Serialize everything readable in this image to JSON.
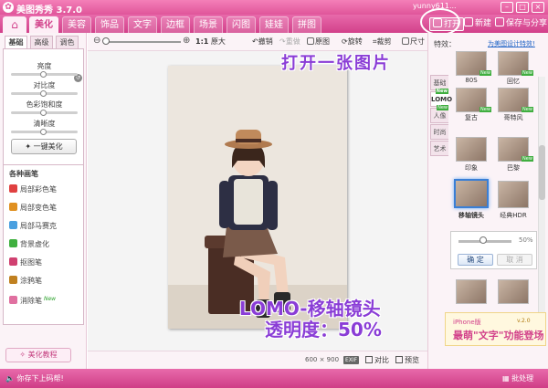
{
  "window": {
    "title": "美图秀秀 3.7.0",
    "user": "yunny611..."
  },
  "tabs": [
    "美化",
    "美容",
    "饰品",
    "文字",
    "边框",
    "场景",
    "闪图",
    "娃娃",
    "拼图"
  ],
  "top_actions": {
    "open": "打开",
    "new": "新建",
    "save": "保存与分享"
  },
  "left_panel": {
    "subtabs": [
      "基础",
      "高级",
      "调色"
    ],
    "sliders": [
      "亮度",
      "对比度",
      "色彩饱和度",
      "清晰度"
    ],
    "one_key": "一键美化",
    "pens_title": "各种画笔",
    "pens": [
      {
        "label": "局部彩色笔",
        "icon": "color-pen-icon",
        "color": "#e04040"
      },
      {
        "label": "局部变色笔",
        "icon": "change-color-pen-icon",
        "color": "#e09020"
      },
      {
        "label": "局部马赛克",
        "icon": "mosaic-icon",
        "color": "#4aa0e0"
      },
      {
        "label": "背景虚化",
        "icon": "blur-icon",
        "color": "#40b040"
      },
      {
        "label": "抠图笔",
        "icon": "cutout-pen-icon",
        "color": "#d04070"
      },
      {
        "label": "涂鸦笔",
        "icon": "doodle-pen-icon",
        "color": "#c08020"
      },
      {
        "label": "消除笔",
        "icon": "eraser-pen-icon",
        "color": "#e070a0",
        "badge": "New"
      }
    ],
    "tutorial": "美化教程"
  },
  "toolbar": {
    "actual_size_prefix": "1:1",
    "actual_size": "原大",
    "undo": "撤销",
    "redo": "重做",
    "original": "原图",
    "rotate": "旋转",
    "crop": "裁剪",
    "resize": "尺寸"
  },
  "canvas": {
    "size": "600 × 900",
    "exif": "EXIF",
    "compare": "对比",
    "preview": "预览"
  },
  "right_panel": {
    "heading": "特效：",
    "link": "为美图设计特效!",
    "vtabs": [
      {
        "label": "基础"
      },
      {
        "label": "LOMO",
        "badge": "New"
      },
      {
        "label": "人像",
        "badge": "New"
      },
      {
        "label": "时尚"
      },
      {
        "label": "艺术"
      }
    ],
    "thumbnails": [
      {
        "label": "80S",
        "badge": "New"
      },
      {
        "label": "回忆",
        "badge": "New"
      },
      {
        "label": "复古",
        "badge": "New"
      },
      {
        "label": "哥特风",
        "badge": "New"
      },
      {
        "label": "印象"
      },
      {
        "label": "巴黎",
        "badge": "New"
      },
      {
        "label": "移轴镜头",
        "selected": true
      },
      {
        "label": "经典HDR"
      }
    ],
    "opacity": {
      "value": "50%",
      "percent": 50,
      "confirm": "确 定",
      "cancel": "取 消"
    },
    "ad": {
      "line1": "iPhone版",
      "version": "v.2.0",
      "line2": "最萌\"文字\"功能登场"
    }
  },
  "status": {
    "message": "你存下上码帮!",
    "batch": "批处理"
  },
  "annotations": {
    "open": "打开一张图片",
    "lomo": "LOMO-移轴镜头",
    "opacity": "透明度：50%"
  },
  "colors": {
    "brand": "#e0559a",
    "accent": "#d2408a",
    "annotation": "#8a3dd6"
  }
}
